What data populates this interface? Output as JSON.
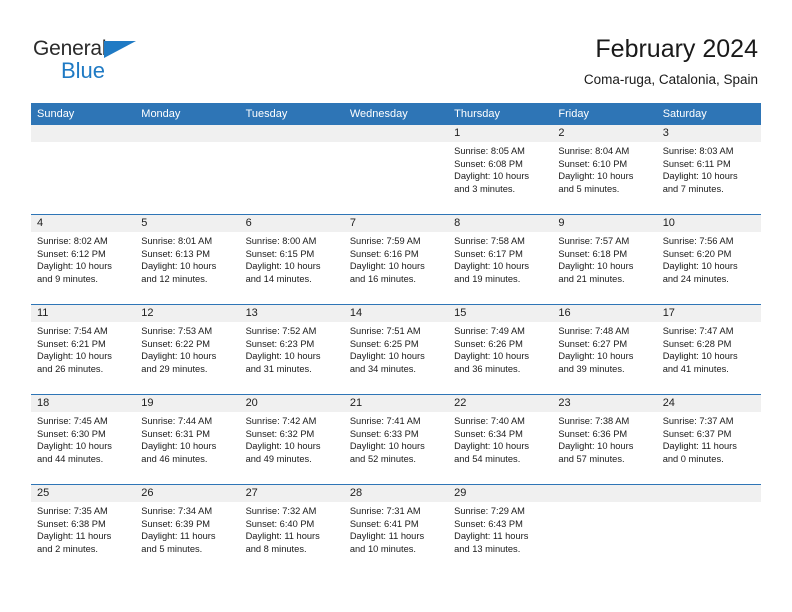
{
  "brand": {
    "name_part1": "General",
    "name_part2": "Blue",
    "triangle_icon": "triangle-icon",
    "color_dark": "#2b2b2b",
    "color_blue": "#1f7ac4"
  },
  "header": {
    "title": "February 2024",
    "subtitle": "Coma-ruga, Catalonia, Spain"
  },
  "colors": {
    "header_blue": "#2e75b6",
    "date_band_gray": "#f0f0f0",
    "text": "#1a1a1a"
  },
  "weekdays": [
    "Sunday",
    "Monday",
    "Tuesday",
    "Wednesday",
    "Thursday",
    "Friday",
    "Saturday"
  ],
  "weeks": [
    [
      {
        "day": "",
        "lines": []
      },
      {
        "day": "",
        "lines": []
      },
      {
        "day": "",
        "lines": []
      },
      {
        "day": "",
        "lines": []
      },
      {
        "day": "1",
        "lines": [
          "Sunrise: 8:05 AM",
          "Sunset: 6:08 PM",
          "Daylight: 10 hours",
          "and 3 minutes."
        ]
      },
      {
        "day": "2",
        "lines": [
          "Sunrise: 8:04 AM",
          "Sunset: 6:10 PM",
          "Daylight: 10 hours",
          "and 5 minutes."
        ]
      },
      {
        "day": "3",
        "lines": [
          "Sunrise: 8:03 AM",
          "Sunset: 6:11 PM",
          "Daylight: 10 hours",
          "and 7 minutes."
        ]
      }
    ],
    [
      {
        "day": "4",
        "lines": [
          "Sunrise: 8:02 AM",
          "Sunset: 6:12 PM",
          "Daylight: 10 hours",
          "and 9 minutes."
        ]
      },
      {
        "day": "5",
        "lines": [
          "Sunrise: 8:01 AM",
          "Sunset: 6:13 PM",
          "Daylight: 10 hours",
          "and 12 minutes."
        ]
      },
      {
        "day": "6",
        "lines": [
          "Sunrise: 8:00 AM",
          "Sunset: 6:15 PM",
          "Daylight: 10 hours",
          "and 14 minutes."
        ]
      },
      {
        "day": "7",
        "lines": [
          "Sunrise: 7:59 AM",
          "Sunset: 6:16 PM",
          "Daylight: 10 hours",
          "and 16 minutes."
        ]
      },
      {
        "day": "8",
        "lines": [
          "Sunrise: 7:58 AM",
          "Sunset: 6:17 PM",
          "Daylight: 10 hours",
          "and 19 minutes."
        ]
      },
      {
        "day": "9",
        "lines": [
          "Sunrise: 7:57 AM",
          "Sunset: 6:18 PM",
          "Daylight: 10 hours",
          "and 21 minutes."
        ]
      },
      {
        "day": "10",
        "lines": [
          "Sunrise: 7:56 AM",
          "Sunset: 6:20 PM",
          "Daylight: 10 hours",
          "and 24 minutes."
        ]
      }
    ],
    [
      {
        "day": "11",
        "lines": [
          "Sunrise: 7:54 AM",
          "Sunset: 6:21 PM",
          "Daylight: 10 hours",
          "and 26 minutes."
        ]
      },
      {
        "day": "12",
        "lines": [
          "Sunrise: 7:53 AM",
          "Sunset: 6:22 PM",
          "Daylight: 10 hours",
          "and 29 minutes."
        ]
      },
      {
        "day": "13",
        "lines": [
          "Sunrise: 7:52 AM",
          "Sunset: 6:23 PM",
          "Daylight: 10 hours",
          "and 31 minutes."
        ]
      },
      {
        "day": "14",
        "lines": [
          "Sunrise: 7:51 AM",
          "Sunset: 6:25 PM",
          "Daylight: 10 hours",
          "and 34 minutes."
        ]
      },
      {
        "day": "15",
        "lines": [
          "Sunrise: 7:49 AM",
          "Sunset: 6:26 PM",
          "Daylight: 10 hours",
          "and 36 minutes."
        ]
      },
      {
        "day": "16",
        "lines": [
          "Sunrise: 7:48 AM",
          "Sunset: 6:27 PM",
          "Daylight: 10 hours",
          "and 39 minutes."
        ]
      },
      {
        "day": "17",
        "lines": [
          "Sunrise: 7:47 AM",
          "Sunset: 6:28 PM",
          "Daylight: 10 hours",
          "and 41 minutes."
        ]
      }
    ],
    [
      {
        "day": "18",
        "lines": [
          "Sunrise: 7:45 AM",
          "Sunset: 6:30 PM",
          "Daylight: 10 hours",
          "and 44 minutes."
        ]
      },
      {
        "day": "19",
        "lines": [
          "Sunrise: 7:44 AM",
          "Sunset: 6:31 PM",
          "Daylight: 10 hours",
          "and 46 minutes."
        ]
      },
      {
        "day": "20",
        "lines": [
          "Sunrise: 7:42 AM",
          "Sunset: 6:32 PM",
          "Daylight: 10 hours",
          "and 49 minutes."
        ]
      },
      {
        "day": "21",
        "lines": [
          "Sunrise: 7:41 AM",
          "Sunset: 6:33 PM",
          "Daylight: 10 hours",
          "and 52 minutes."
        ]
      },
      {
        "day": "22",
        "lines": [
          "Sunrise: 7:40 AM",
          "Sunset: 6:34 PM",
          "Daylight: 10 hours",
          "and 54 minutes."
        ]
      },
      {
        "day": "23",
        "lines": [
          "Sunrise: 7:38 AM",
          "Sunset: 6:36 PM",
          "Daylight: 10 hours",
          "and 57 minutes."
        ]
      },
      {
        "day": "24",
        "lines": [
          "Sunrise: 7:37 AM",
          "Sunset: 6:37 PM",
          "Daylight: 11 hours",
          "and 0 minutes."
        ]
      }
    ],
    [
      {
        "day": "25",
        "lines": [
          "Sunrise: 7:35 AM",
          "Sunset: 6:38 PM",
          "Daylight: 11 hours",
          "and 2 minutes."
        ]
      },
      {
        "day": "26",
        "lines": [
          "Sunrise: 7:34 AM",
          "Sunset: 6:39 PM",
          "Daylight: 11 hours",
          "and 5 minutes."
        ]
      },
      {
        "day": "27",
        "lines": [
          "Sunrise: 7:32 AM",
          "Sunset: 6:40 PM",
          "Daylight: 11 hours",
          "and 8 minutes."
        ]
      },
      {
        "day": "28",
        "lines": [
          "Sunrise: 7:31 AM",
          "Sunset: 6:41 PM",
          "Daylight: 11 hours",
          "and 10 minutes."
        ]
      },
      {
        "day": "29",
        "lines": [
          "Sunrise: 7:29 AM",
          "Sunset: 6:43 PM",
          "Daylight: 11 hours",
          "and 13 minutes."
        ]
      },
      {
        "day": "",
        "lines": []
      },
      {
        "day": "",
        "lines": []
      }
    ]
  ]
}
